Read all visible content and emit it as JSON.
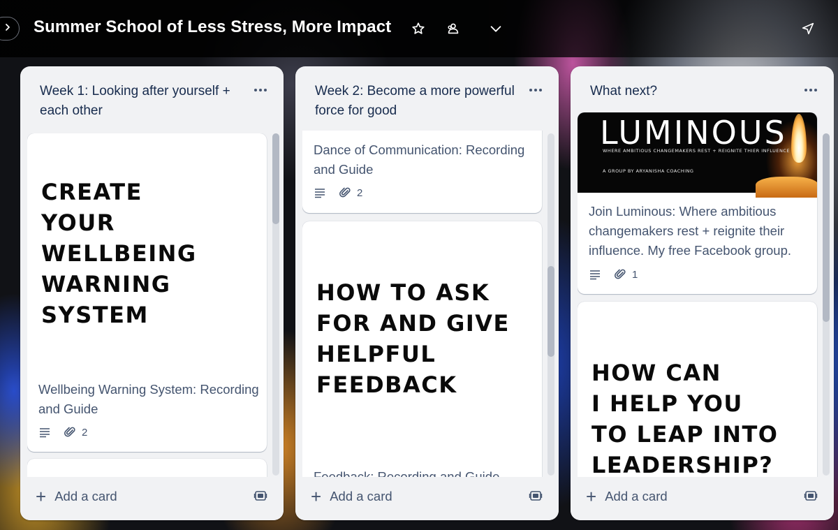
{
  "header": {
    "title": "Summer School of Less Stress, More Impact"
  },
  "lists": [
    {
      "title": "Week 1: Looking after yourself + each other",
      "cards": [
        {
          "cover_text": "CREATE\nYOUR\nWELLBEING\nWARNING\nSYSTEM",
          "name": "Wellbeing Warning System: Recording and Guide",
          "attachments": "2"
        }
      ],
      "add_card_label": "Add a card"
    },
    {
      "title": "Week 2: Become a more powerful force for good",
      "cards": [
        {
          "name": "Dance of Communication: Recording and Guide",
          "attachments": "2"
        },
        {
          "cover_text": "HOW TO ASK\nFOR AND GIVE\nHELPFUL\nFEEDBACK",
          "name": "Feedback: Recording and Guide"
        }
      ],
      "add_card_label": "Add a card"
    },
    {
      "title": "What next?",
      "cards": [
        {
          "cover_title": "LUMINOUS",
          "cover_subtitle": "WHERE AMBITIOUS CHANGEMAKERS REST + REIGNITE THIER INFLUENCE",
          "cover_byline": "A GROUP BY ARYANISHA COACHING",
          "name": "Join Luminous: Where ambitious changemakers rest + reignite their influence. My free Facebook group.",
          "attachments": "1"
        },
        {
          "cover_text": "HOW CAN\nI HELP YOU\nTO LEAP INTO\nLEADERSHIP?"
        }
      ],
      "add_card_label": "Add a card"
    }
  ]
}
